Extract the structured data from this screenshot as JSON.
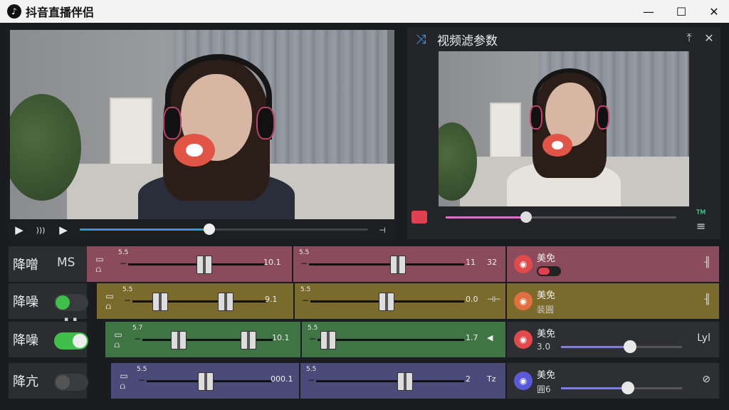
{
  "window": {
    "title": "抖音直播伴侣",
    "logo_icon": "douyin-logo-icon",
    "minimize": "—",
    "maximize": "☐",
    "close": "✕"
  },
  "player": {
    "play": "▶",
    "volume": ")))",
    "next": "▶",
    "end": "⊣",
    "progress_pct": 45
  },
  "filter_panel": {
    "title": "视频滤参数",
    "shuffle_icon": "⤨",
    "pin": "⤒",
    "close": "✕",
    "progress_pct": 35,
    "corner_label": "TM",
    "menu": "≡"
  },
  "colors": {
    "row1": "#8a4b5c",
    "row2": "#7a6a2c",
    "row3": "#3f7445",
    "row4": "#4b4b7a",
    "fx_dark": "#2e2f33"
  },
  "rows": [
    {
      "label": "降噌",
      "mode": "MS",
      "seg1_label": "5.5",
      "seg1_value": "10.1",
      "seg2_label": "5.5",
      "seg2_value": "11",
      "seg2_icon": "32",
      "fx_name": "美免",
      "fx_sub": "",
      "fx_end": "╢"
    },
    {
      "label": "降噪",
      "seg1_label": "5.5",
      "seg1_value": "9.1",
      "seg2_label": "5.5",
      "seg2_value": "0.0",
      "seg2_icon": "⊣⊢",
      "fx_name": "美免",
      "fx_sub": "装圓",
      "fx_end": "╢"
    },
    {
      "label": "降噪",
      "dots": "▪▪",
      "seg1_label": "5.7",
      "seg1_value": "10.1",
      "seg2_label": "5.5",
      "seg2_value": "1.7",
      "seg2_icon": "◀",
      "fx_name": "美免",
      "fx_sub": "3.0",
      "fx_end": "Lyl",
      "fx_slider_pct": 57
    },
    {
      "label": "降亢",
      "seg1_label": "5.5",
      "seg1_value": "000.1",
      "seg2_label": "5.5",
      "seg2_value": "2",
      "seg2_icon": "Tz",
      "fx_name": "美免",
      "fx_sub": "圓6",
      "fx_end": "⊘",
      "fx_slider_pct": 55
    }
  ]
}
